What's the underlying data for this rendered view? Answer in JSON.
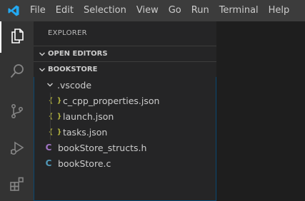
{
  "menu": {
    "items": [
      "File",
      "Edit",
      "Selection",
      "View",
      "Go",
      "Run",
      "Terminal",
      "Help"
    ]
  },
  "activity_bar": {
    "items": [
      {
        "name": "explorer-icon",
        "active": true
      },
      {
        "name": "search-icon",
        "active": false
      },
      {
        "name": "source-control-icon",
        "active": false
      },
      {
        "name": "run-debug-icon",
        "active": false
      },
      {
        "name": "extensions-icon",
        "active": false
      }
    ]
  },
  "sidebar": {
    "title": "EXPLORER",
    "open_editors_label": "OPEN EDITORS",
    "folder_label": "BOOKSTORE",
    "tree": {
      "vscode_folder": ".vscode",
      "files": {
        "c_cpp_properties": "c_cpp_properties.json",
        "launch": "launch.json",
        "tasks": "tasks.json",
        "structs_h": "bookStore_structs.h",
        "main_c": "bookStore.c"
      },
      "json_icon": "{ }",
      "c_icon": "C"
    }
  },
  "colors": {
    "accent": "#007acc",
    "json_icon": "#cbcb41",
    "header_file_icon": "#a074c4",
    "c_file_icon": "#519aba",
    "focus_border": "#094771"
  }
}
